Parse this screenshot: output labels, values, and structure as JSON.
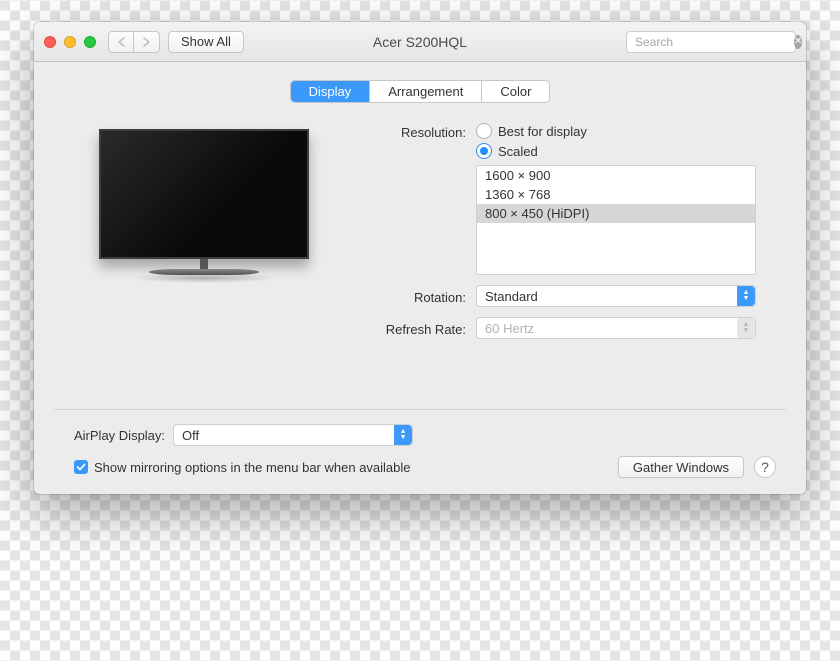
{
  "header": {
    "show_all_label": "Show All",
    "title": "Acer S200HQL",
    "search_placeholder": "Search"
  },
  "tabs": [
    {
      "label": "Display",
      "active": true
    },
    {
      "label": "Arrangement",
      "active": false
    },
    {
      "label": "Color",
      "active": false
    }
  ],
  "resolution": {
    "label": "Resolution:",
    "best_label": "Best for display",
    "scaled_label": "Scaled",
    "selected_mode": "scaled",
    "list": [
      {
        "text": "1600 × 900",
        "selected": false
      },
      {
        "text": "1360 × 768",
        "selected": false
      },
      {
        "text": "800 × 450 (HiDPI)",
        "selected": true
      }
    ]
  },
  "rotation": {
    "label": "Rotation:",
    "value": "Standard"
  },
  "refresh": {
    "label": "Refresh Rate:",
    "value": "60 Hertz"
  },
  "airplay": {
    "label": "AirPlay Display:",
    "value": "Off"
  },
  "mirroring": {
    "label": "Show mirroring options in the menu bar when available",
    "checked": true
  },
  "gather_label": "Gather Windows",
  "help_label": "?"
}
